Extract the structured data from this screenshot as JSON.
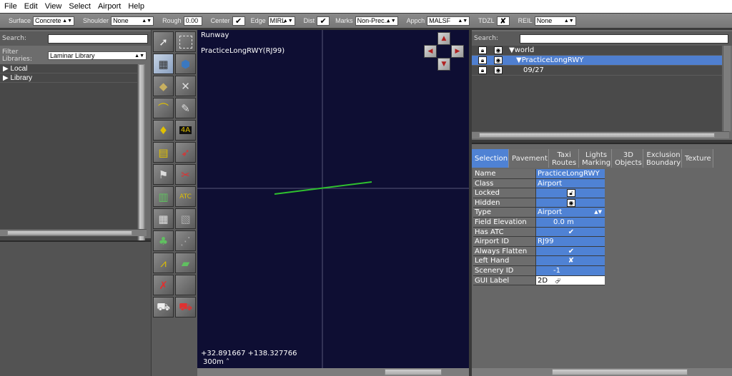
{
  "menu": [
    "File",
    "Edit",
    "View",
    "Select",
    "Airport",
    "Help"
  ],
  "toolbar": {
    "surface_label": "Surface",
    "surface_value": "Concrete",
    "shoulder_label": "Shoulder",
    "shoulder_value": "None",
    "rough_label": "Rough",
    "rough_value": "0.00",
    "center_label": "Center",
    "edge_label": "Edge",
    "edge_value": "MIRL",
    "dist_label": "Dist",
    "marks_label": "Marks",
    "marks_value": "Non-Prec...",
    "appch_label": "Appch",
    "appch_value": "MALSF",
    "tdzl_label": "TDZL",
    "reil_label": "REIL",
    "reil_value": "None"
  },
  "library": {
    "search_label": "Search:",
    "filter_label": "Filter Libraries:",
    "filter_value": "Laminar Library",
    "items": [
      "Local",
      "Library"
    ]
  },
  "viewport": {
    "title": "Runway",
    "subtitle": "PracticeLongRWY(RJ99)",
    "coords": "+32.891667 +138.327766",
    "scale": "300m"
  },
  "hierarchy": {
    "search_label": "Search:",
    "rows": [
      {
        "label": "world",
        "selected": false
      },
      {
        "label": "PracticeLongRWY",
        "selected": true
      },
      {
        "label": "09/27",
        "selected": false
      }
    ]
  },
  "tabs": [
    {
      "label": "Selection",
      "active": true
    },
    {
      "label": "Pavement",
      "active": false
    },
    {
      "label": "Taxi Routes",
      "active": false
    },
    {
      "label": "Lights Marking",
      "active": false
    },
    {
      "label": "3D Objects",
      "active": false
    },
    {
      "label": "Exclusion Boundary",
      "active": false
    },
    {
      "label": "Texture",
      "active": false
    }
  ],
  "properties": {
    "names": [
      "Name",
      "Class",
      "Locked",
      "Hidden",
      "Type",
      "Field Elevation",
      "Has ATC",
      "Airport ID",
      "Always Flatten",
      "Left Hand Driving",
      "Scenery ID",
      "GUI Label"
    ],
    "values": [
      "PracticeLongRWY",
      "Airport",
      "",
      "",
      "Airport",
      "0.0 m",
      "",
      "RJ99",
      "",
      "",
      "-1",
      "2D"
    ]
  }
}
